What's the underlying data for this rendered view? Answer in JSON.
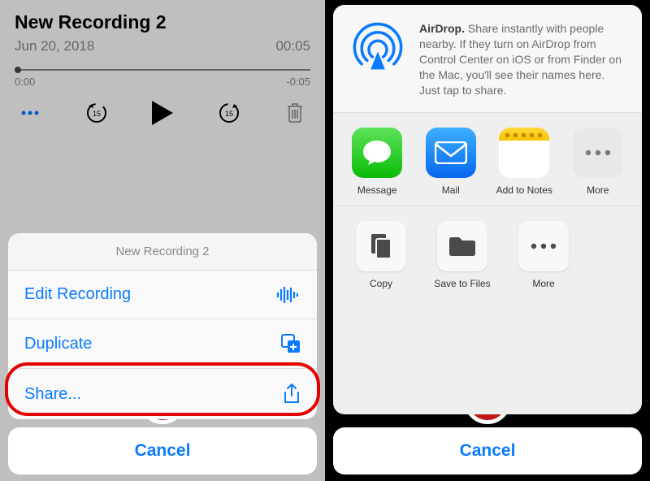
{
  "left": {
    "title": "New Recording 2",
    "date": "Jun 20, 2018",
    "duration": "00:05",
    "time_start": "0:00",
    "time_remaining": "-0:05",
    "sheet_title": "New Recording 2",
    "actions": {
      "edit": "Edit Recording",
      "duplicate": "Duplicate",
      "share": "Share..."
    },
    "cancel": "Cancel"
  },
  "right": {
    "airdrop_bold": "AirDrop.",
    "airdrop_text": " Share instantly with people nearby. If they turn on AirDrop from Control Center on iOS or from Finder on the Mac, you'll see their names here. Just tap to share.",
    "apps": {
      "message": "Message",
      "mail": "Mail",
      "notes": "Add to Notes",
      "more": "More"
    },
    "actions": {
      "copy": "Copy",
      "save": "Save to Files",
      "more": "More"
    },
    "cancel": "Cancel"
  }
}
